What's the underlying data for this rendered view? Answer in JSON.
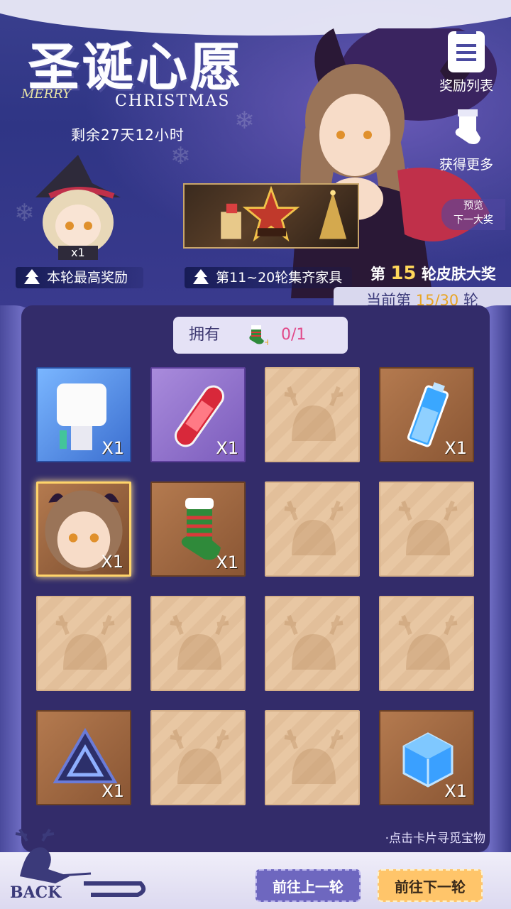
{
  "header": {
    "title_cn": "圣诞心愿",
    "title_en_1": "MERRY",
    "title_en_2": "CHRISTMAS",
    "countdown": "剩余27天12小时",
    "reward_list_label": "奖励列表",
    "get_more_label": "获得更多",
    "preview_label": "预览",
    "preview_label_2": "下一大奖",
    "chibi_count": "x1",
    "top_reward_label": "本轮最高奖励",
    "furniture_label": "第11~20轮集齐家具",
    "skin_prefix": "第",
    "skin_round": "15",
    "skin_suffix": "轮皮肤大奖",
    "current_round_prefix": "当前第",
    "current_round": "15/30",
    "current_round_suffix": "轮"
  },
  "owned": {
    "label": "拥有",
    "count": "0/1"
  },
  "cards": [
    {
      "type": "character-robot",
      "qty": "X1"
    },
    {
      "type": "red-capsule",
      "qty": "X1"
    },
    {
      "type": "empty",
      "qty": ""
    },
    {
      "type": "battery",
      "qty": "X1"
    },
    {
      "type": "character-girl",
      "qty": "X1"
    },
    {
      "type": "christmas-sock",
      "qty": "X1"
    },
    {
      "type": "empty",
      "qty": ""
    },
    {
      "type": "empty",
      "qty": ""
    },
    {
      "type": "empty",
      "qty": ""
    },
    {
      "type": "empty",
      "qty": ""
    },
    {
      "type": "empty",
      "qty": ""
    },
    {
      "type": "empty",
      "qty": ""
    },
    {
      "type": "core-triangle",
      "qty": "X1"
    },
    {
      "type": "empty",
      "qty": ""
    },
    {
      "type": "empty",
      "qty": ""
    },
    {
      "type": "blue-cube",
      "qty": "X1"
    }
  ],
  "footer": {
    "hint": "·点击卡片寻觅宝物",
    "back_label": "BACK",
    "prev_round": "前往上一轮",
    "next_round": "前往下一轮"
  }
}
